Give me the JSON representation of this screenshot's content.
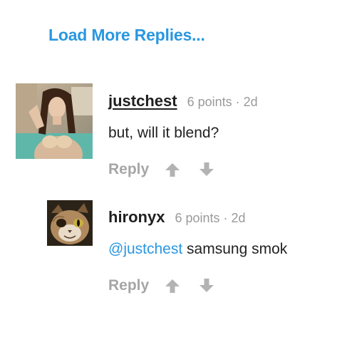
{
  "thread": {
    "load_more_label": "Load More Replies..."
  },
  "comments": [
    {
      "username": "justchest",
      "points": "6 points",
      "separator": "·",
      "age": "2d",
      "mention": "",
      "text": "but, will it blend?",
      "reply_label": "Reply",
      "avatar": "woman-photo-avatar"
    },
    {
      "username": "hironyx",
      "points": "6 points",
      "separator": "·",
      "age": "2d",
      "mention": "@justchest",
      "text": " samsung smok",
      "reply_label": "Reply",
      "avatar": "cat-photo-avatar"
    }
  ],
  "icons": {
    "upvote": "arrow-up-icon",
    "downvote": "arrow-down-icon"
  },
  "colors": {
    "link": "#2a97e0",
    "meta": "#9a9a9a",
    "action": "#a6a6a6",
    "text": "#222222"
  }
}
